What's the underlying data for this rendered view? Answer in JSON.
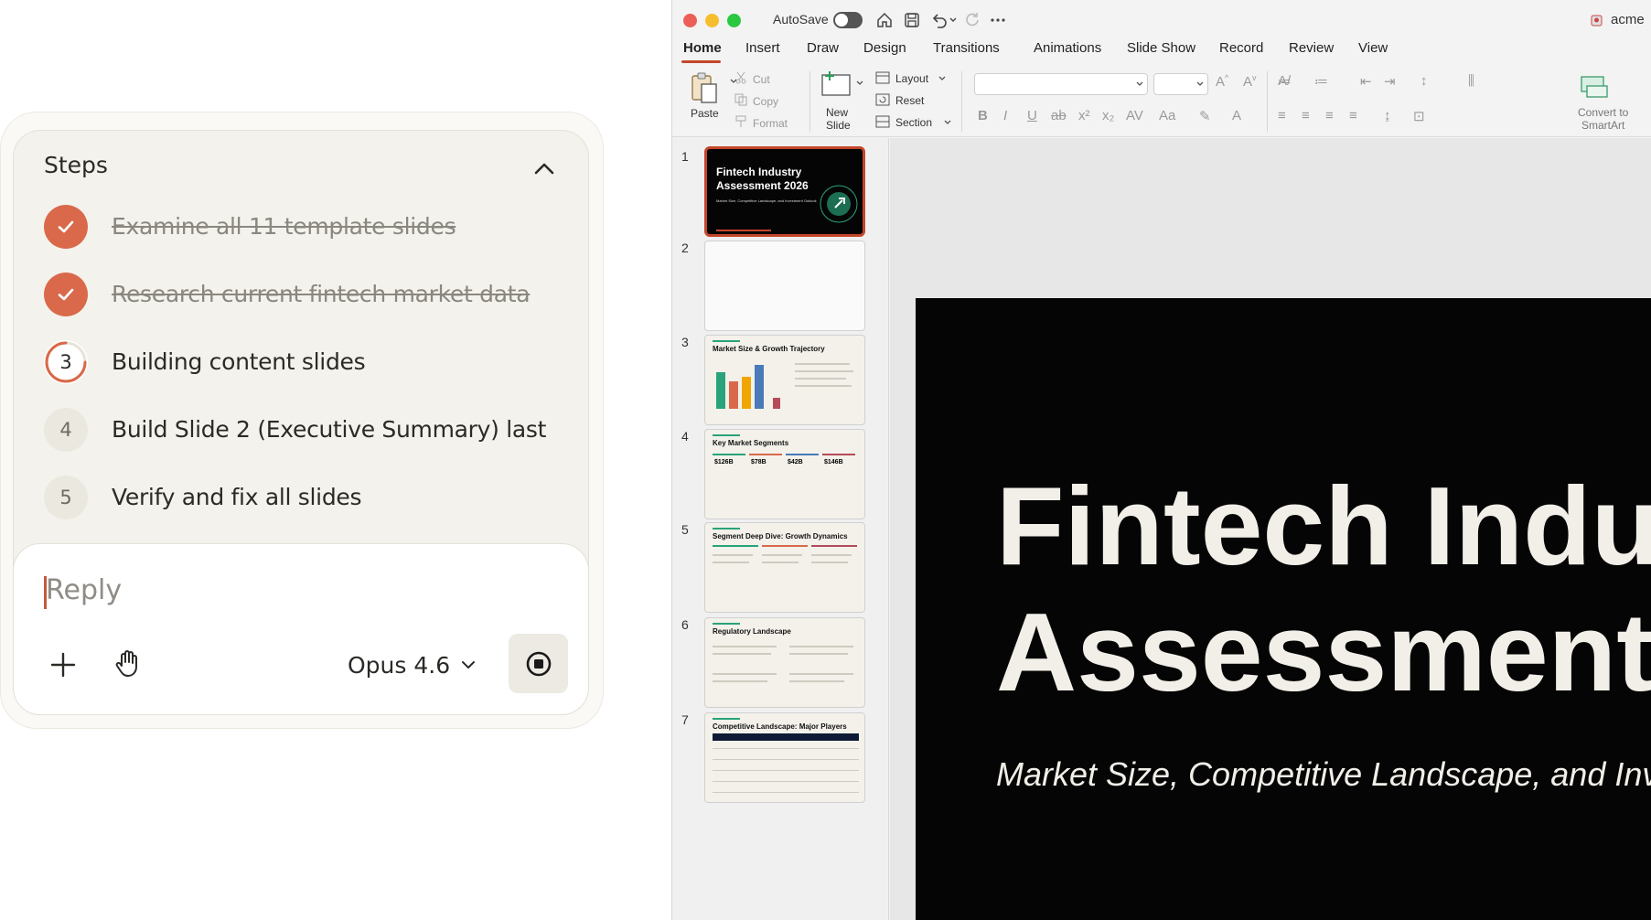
{
  "steps_panel": {
    "title": "Steps",
    "items": [
      {
        "marker": "",
        "label": "Examine all 11 template slides",
        "state": "done"
      },
      {
        "marker": "",
        "label": "Research current fintech market data",
        "state": "done"
      },
      {
        "marker": "3",
        "label": "Building content slides",
        "state": "active"
      },
      {
        "marker": "4",
        "label": "Build Slide 2 (Executive Summary) last",
        "state": "pending"
      },
      {
        "marker": "5",
        "label": "Verify and fix all slides",
        "state": "pending"
      }
    ]
  },
  "composer": {
    "placeholder": "Reply",
    "model": "Opus 4.6"
  },
  "ppt": {
    "titlebar": {
      "autosave_label": "AutoSave",
      "autosave_on": false,
      "account": "acme"
    },
    "tabs": [
      "Home",
      "Insert",
      "Draw",
      "Design",
      "Transitions",
      "Animations",
      "Slide Show",
      "Record",
      "Review",
      "View"
    ],
    "active_tab": "Home",
    "ribbon": {
      "paste": "Paste",
      "cut": "Cut",
      "copy": "Copy",
      "format": "Format",
      "new_slide_1": "New",
      "new_slide_2": "Slide",
      "layout": "Layout",
      "reset": "Reset",
      "section": "Section",
      "convert_1": "Convert to",
      "convert_2": "SmartArt"
    },
    "thumbnails": [
      {
        "num": "1",
        "title_1": "Fintech Industry",
        "title_2": "Assessment 2026",
        "subtitle": "Market Size, Competitive Landscape, and Investment Outlook"
      },
      {
        "num": "2",
        "title": ""
      },
      {
        "num": "3",
        "title": "Market Size & Growth Trajectory"
      },
      {
        "num": "4",
        "title": "Key Market Segments",
        "values": [
          "$126B",
          "$78B",
          "$42B",
          "$146B"
        ]
      },
      {
        "num": "5",
        "title": "Segment Deep Dive: Growth Dynamics"
      },
      {
        "num": "6",
        "title": "Regulatory Landscape"
      },
      {
        "num": "7",
        "title": "Competitive Landscape: Major Players"
      }
    ],
    "slide": {
      "title_line1": "Fintech Indu",
      "title_line2": "Assessment",
      "subtitle": "Market Size, Competitive Landscape, and Inve"
    },
    "colors": {
      "accent": "#c4462a",
      "step_done": "#d9694a",
      "slide_bg": "#050505",
      "teal": "#2aa37a"
    }
  }
}
